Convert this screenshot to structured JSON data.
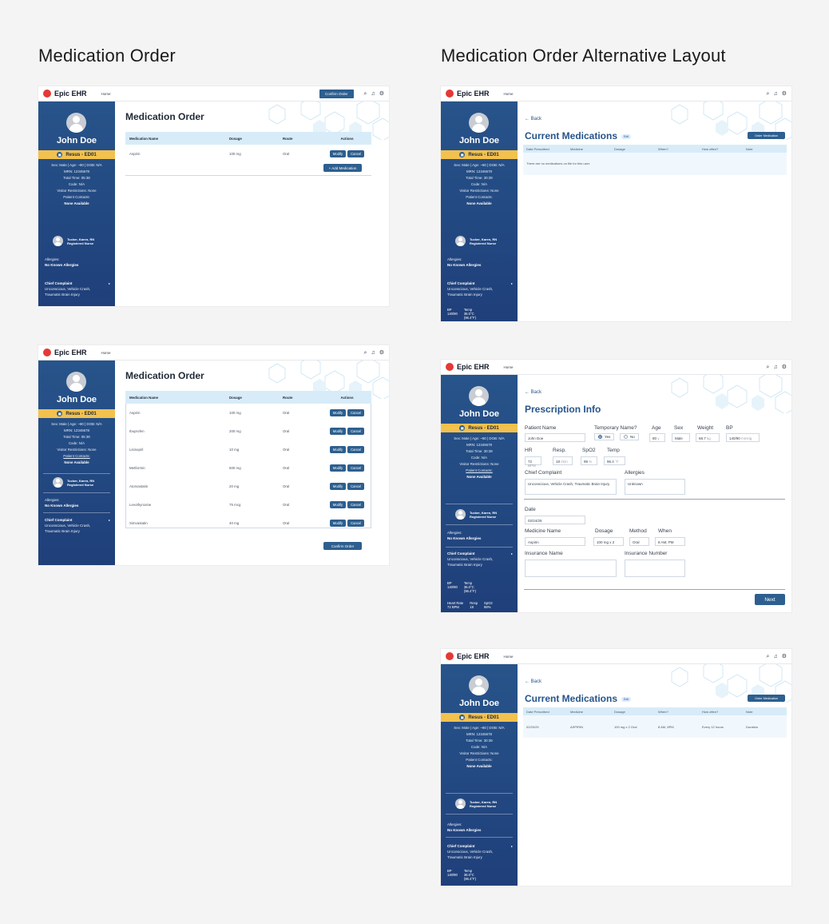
{
  "titles": {
    "left": "Medication Order",
    "right": "Medication Order Alternative Layout"
  },
  "topbar": {
    "logo": "Epic EHR",
    "home": "Home",
    "confirm_order": "Confirm Order"
  },
  "icons": [
    "search-icon",
    "bell-icon",
    "gear-icon"
  ],
  "colors": {
    "brand": "#2d5f8f",
    "sidebar": "#27548a",
    "resus": "#f2c14e",
    "table_header": "#d7ecf8"
  },
  "patient": {
    "name": "John Doe",
    "location": "Resus - ED01",
    "demo_line": "Sex: Male | Age: ~80 | DOB: N/A",
    "mrn": "MRN: 12345678",
    "total_time": "Total Time: 05:38",
    "total_time_b": "Total Time: 30:39",
    "code": "Code: N/A",
    "visitor": "Visitor Restrictions: None",
    "contacts": "Patient Contacts:",
    "contacts_value": "None Available",
    "nurse_name": "Tucker, Karen, RN",
    "nurse_role": "Registered Nurse",
    "allergies_label": "Allergies:",
    "allergies_value": "No Known Allergies",
    "cc_label": "Chief Complaint",
    "cc_value_1": "Unconscious, Vehicle Crash,",
    "cc_value_2": "Traumatic Brain Injury",
    "vitals": {
      "bp_label": "BP",
      "bp": "140/90",
      "temp_label": "Temp",
      "temp": "36.0°C",
      "temp_f": "(96.4°F)",
      "hr_label": "Heart Rate",
      "hr": "72 BPM",
      "resp_label": "Resp",
      "resp": "18",
      "spo2_label": "SpO2",
      "spo2": "98%"
    }
  },
  "order1": {
    "title": "Medication Order",
    "headers": [
      "Medication Name",
      "Dosage",
      "Route",
      "Actions"
    ],
    "rows": [
      {
        "name": "Aspirin",
        "dosage": "100 mg",
        "route": "Oral"
      }
    ],
    "modify": "Modify",
    "cancel": "Cancel",
    "add_med": "+ Add Medication"
  },
  "order2": {
    "title": "Medication Order",
    "headers": [
      "Medication Name",
      "Dosage",
      "Route",
      "Actions"
    ],
    "rows": [
      {
        "name": "Aspirin",
        "dosage": "100 mg",
        "route": "Oral"
      },
      {
        "name": "Ibuprofen",
        "dosage": "200 mg",
        "route": "Oral"
      },
      {
        "name": "Lisinopril",
        "dosage": "10 mg",
        "route": "Oral"
      },
      {
        "name": "Metformin",
        "dosage": "500 mg",
        "route": "Oral"
      },
      {
        "name": "Atorvastatin",
        "dosage": "20 mg",
        "route": "Oral"
      },
      {
        "name": "Levothyroxine",
        "dosage": "75 mcg",
        "route": "Oral"
      },
      {
        "name": "Simvastatin",
        "dosage": "40 mg",
        "route": "Oral"
      }
    ],
    "confirm": "Confirm Order"
  },
  "current": {
    "back": "← Back",
    "title": "Current Medications",
    "edit": "Edit",
    "order_btn": "Order Medication",
    "headers": [
      "Date Prescribed",
      "Medicine",
      "Dosage",
      "When?",
      "How often?",
      "Note"
    ],
    "empty": "There are no medications on file for this user.",
    "row": {
      "date": "02/20/25",
      "medicine": "ASPIRIN",
      "dosage": "100 mg x 2 Oral",
      "when": "8 AM, 8PM",
      "how": "Every 12 hours",
      "note": "Duration"
    }
  },
  "rx": {
    "back": "← Back",
    "title": "Prescription Info",
    "labels": {
      "patient_name": "Patient Name",
      "temp_name": "Temporary Name?",
      "age": "Age",
      "sex": "Sex",
      "weight": "Weight",
      "bp": "BP",
      "hr": "HR",
      "resp": "Resp.",
      "spo2": "SpO2",
      "temp": "Temp",
      "cc": "Chief Complaint",
      "allergies": "Allergies",
      "date": "Date",
      "medicine": "Medicine Name",
      "dosage": "Dosage",
      "method": "Method",
      "when": "When",
      "ins_name": "Insurance Name",
      "ins_number": "Insurance Number"
    },
    "values": {
      "patient_name": "John Doe",
      "yes": "Yes",
      "no": "No",
      "age": "80",
      "age_unit": "y",
      "sex": "Male",
      "weight": "68.7",
      "weight_unit": "kg",
      "bp": "140/90",
      "bp_unit": "mmHg",
      "hr": "72",
      "hr_unit": "BPM",
      "resp": "18",
      "resp_unit": "/min",
      "spo2": "98",
      "spo2_unit": "%",
      "temp": "96.4",
      "temp_unit": "°F",
      "cc": "Unconscious, Vehicle Crash, Traumatic Brain Injury",
      "allergies": "Unknown",
      "date": "02/24/25",
      "medicine": "Aspirin",
      "dosage": "100 mg x 2",
      "method": "Oral",
      "when": "8 AM, PM"
    },
    "next": "Next"
  }
}
